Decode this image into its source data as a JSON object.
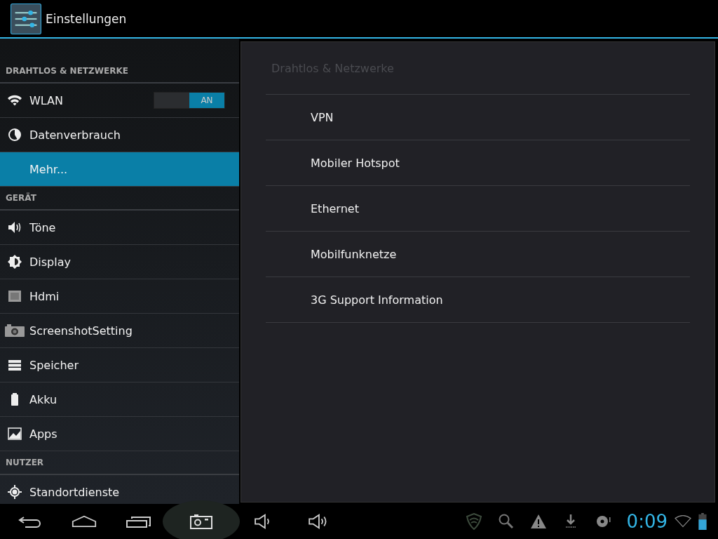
{
  "action_bar": {
    "title": "Einstellungen"
  },
  "sidebar": {
    "sections": [
      {
        "header": "DRAHTLOS & NETZWERKE",
        "items": [
          {
            "label": "WLAN",
            "kind": "toggle",
            "selected": false,
            "toggle": {
              "label": "AN",
              "on": true
            }
          },
          {
            "label": "Datenverbrauch",
            "kind": "plain",
            "selected": false
          },
          {
            "label": "Mehr...",
            "kind": "plain",
            "selected": true
          }
        ]
      },
      {
        "header": "GERÄT",
        "items": [
          {
            "label": "Töne",
            "kind": "plain",
            "selected": false
          },
          {
            "label": "Display",
            "kind": "plain",
            "selected": false
          },
          {
            "label": "Hdmi",
            "kind": "plain",
            "selected": false
          },
          {
            "label": "ScreenshotSetting",
            "kind": "plain",
            "selected": false
          },
          {
            "label": "Speicher",
            "kind": "plain",
            "selected": false
          },
          {
            "label": "Akku",
            "kind": "plain",
            "selected": false
          },
          {
            "label": "Apps",
            "kind": "plain",
            "selected": false
          }
        ]
      },
      {
        "header": "NUTZER",
        "items": [
          {
            "label": "Standortdienste",
            "kind": "plain",
            "selected": false
          }
        ]
      }
    ]
  },
  "detail": {
    "title": "Drahtlos & Netzwerke",
    "items": [
      "VPN",
      "Mobiler Hotspot",
      "Ethernet",
      "Mobilfunknetze",
      "3G Support Information"
    ]
  },
  "status_bar": {
    "time": "0:09"
  }
}
